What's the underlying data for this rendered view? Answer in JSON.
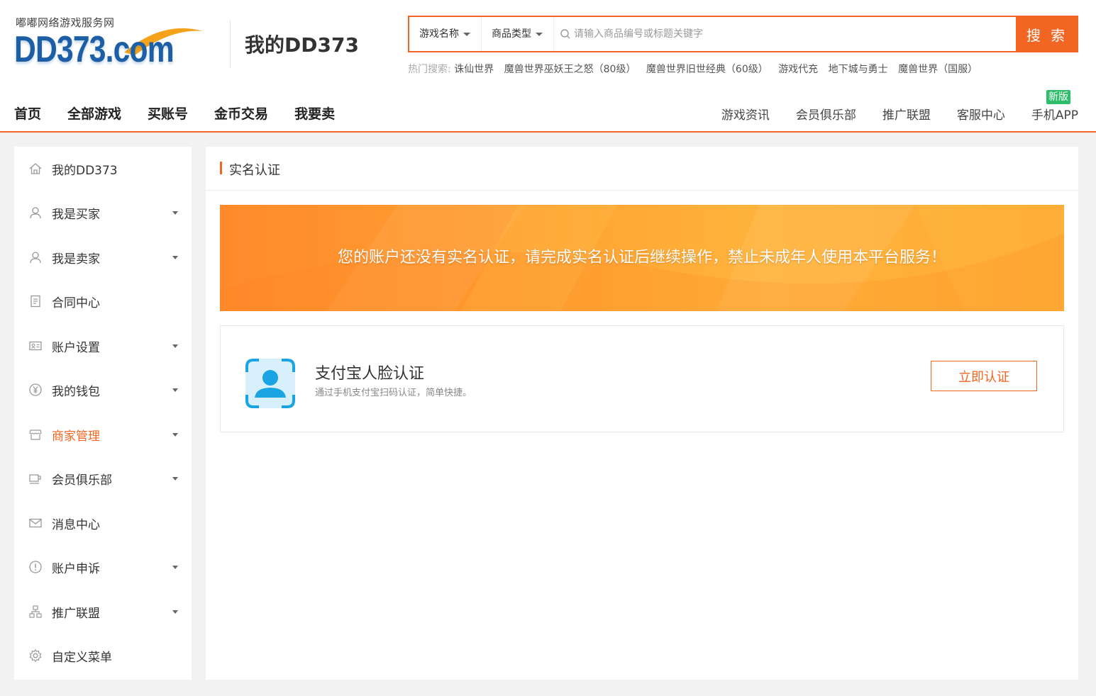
{
  "logo": {
    "subtitle": "嘟嘟网络游戏服务网",
    "main": "DD373.com"
  },
  "page_heading": "我的DD373",
  "search": {
    "dropdown_game": "游戏名称",
    "dropdown_type": "商品类型",
    "placeholder": "请输入商品编号或标题关键字",
    "button": "搜 索"
  },
  "hot_search": {
    "label": "热门搜索:",
    "items": [
      "诛仙世界",
      "魔兽世界巫妖王之怒（80级）",
      "魔兽世界旧世经典（60级）",
      "游戏代充",
      "地下城与勇士",
      "魔兽世界（国服）"
    ]
  },
  "nav_main": [
    "首页",
    "全部游戏",
    "买账号",
    "金币交易",
    "我要卖"
  ],
  "nav_secondary": [
    "游戏资讯",
    "会员俱乐部",
    "推广联盟",
    "客服中心",
    "手机APP"
  ],
  "new_badge": "新版",
  "sidebar": {
    "items": [
      {
        "label": "我的DD373",
        "icon": "home-icon",
        "has_caret": false
      },
      {
        "label": "我是买家",
        "icon": "user-icon",
        "has_caret": true
      },
      {
        "label": "我是卖家",
        "icon": "user-icon",
        "has_caret": true
      },
      {
        "label": "合同中心",
        "icon": "document-icon",
        "has_caret": false
      },
      {
        "label": "账户设置",
        "icon": "id-card-icon",
        "has_caret": true
      },
      {
        "label": "我的钱包",
        "icon": "yen-icon",
        "has_caret": true
      },
      {
        "label": "商家管理",
        "icon": "store-icon",
        "has_caret": true,
        "active": true
      },
      {
        "label": "会员俱乐部",
        "icon": "cup-icon",
        "has_caret": true
      },
      {
        "label": "消息中心",
        "icon": "mail-icon",
        "has_caret": false
      },
      {
        "label": "账户申诉",
        "icon": "alert-icon",
        "has_caret": true
      },
      {
        "label": "推广联盟",
        "icon": "network-icon",
        "has_caret": true
      },
      {
        "label": "自定义菜单",
        "icon": "gear-icon",
        "has_caret": false
      }
    ]
  },
  "main": {
    "title": "实名认证",
    "banner_text": "您的账户还没有实名认证，请完成实名认证后继续操作，禁止未成年人使用本平台服务！",
    "card": {
      "title": "支付宝人脸认证",
      "desc": "通过手机支付宝扫码认证，简单快捷。",
      "button": "立即认证",
      "icon": "face-scan-icon"
    }
  },
  "colors": {
    "accent": "#f26522",
    "logo_blue": "#1d5fa6",
    "banner_orange": "#ffa032",
    "face_icon_blue": "#1aa4e4",
    "new_badge_green": "#2ebd6b"
  }
}
